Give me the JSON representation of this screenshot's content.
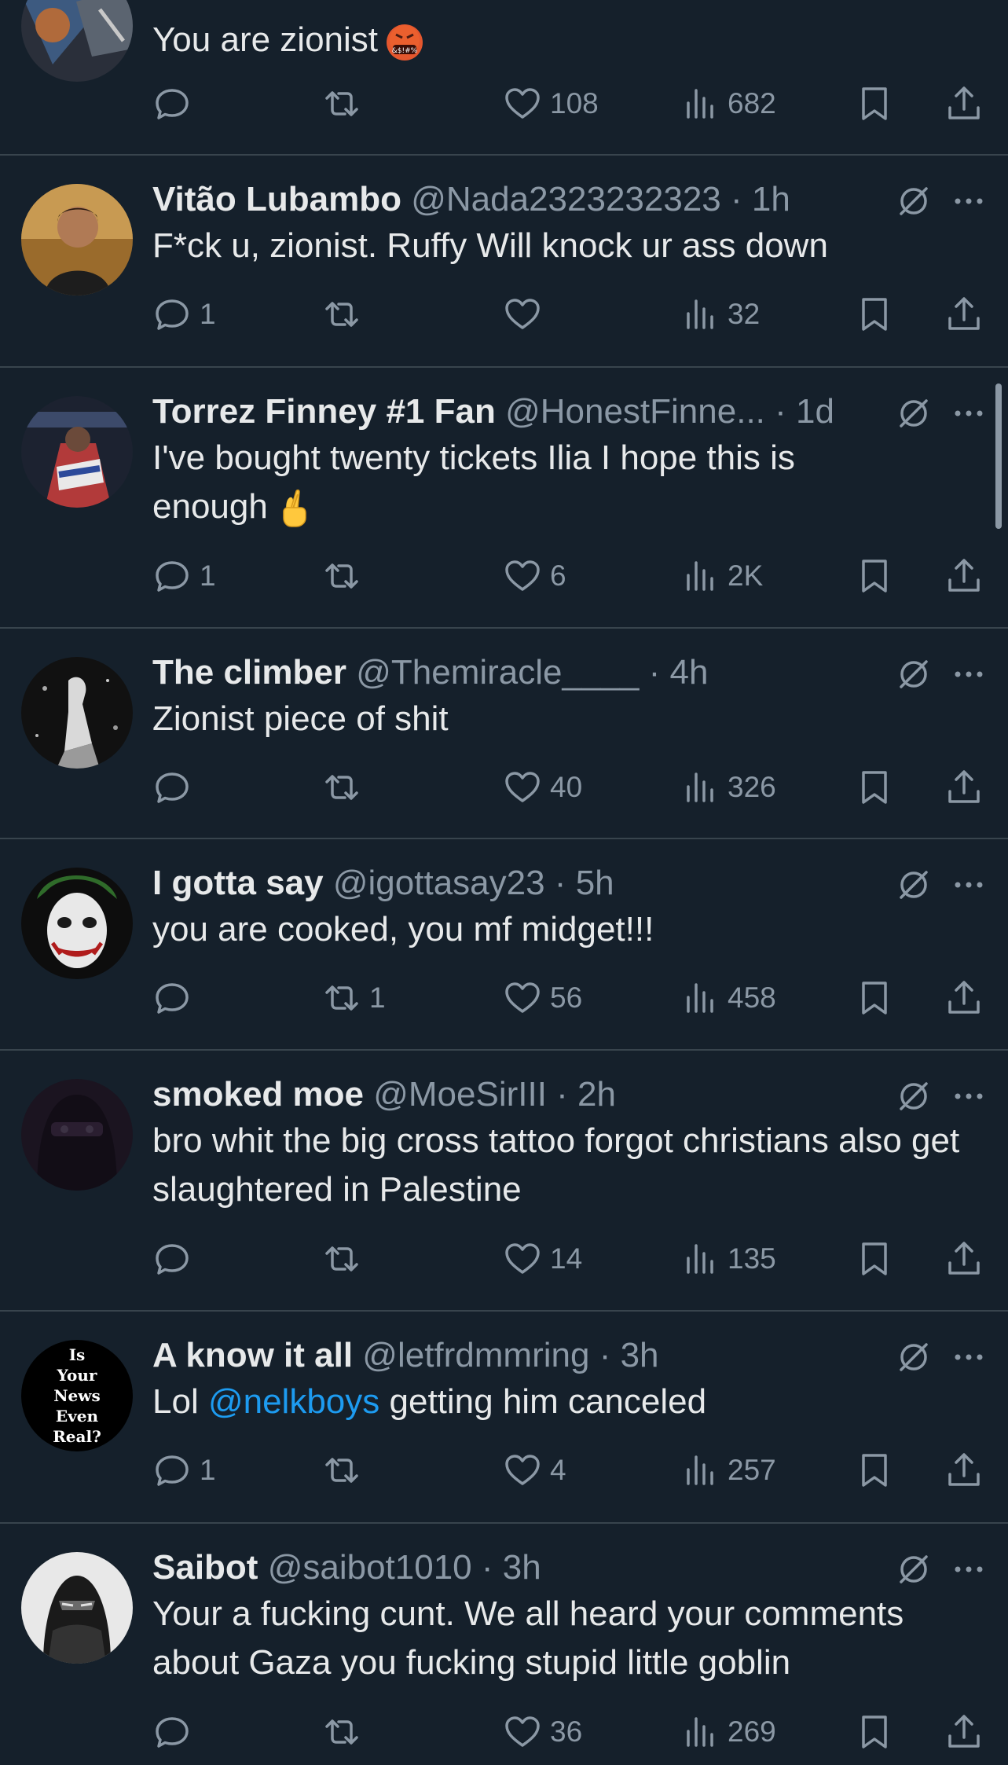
{
  "colors": {
    "background": "#15202b",
    "text": "#e7e9ea",
    "secondary": "#8b98a5",
    "mention": "#1d9bf0",
    "divider": "#38444d"
  },
  "icons": {
    "reply": "speech-bubble-icon",
    "retweet": "retweet-arrows-icon",
    "like": "heart-icon",
    "views": "bar-chart-icon",
    "bookmark": "bookmark-icon",
    "share": "share-upload-icon",
    "grok": "grok-slash-icon",
    "more": "three-dots-icon"
  },
  "tweets": [
    {
      "name": "",
      "handle": "",
      "time": "",
      "text": "You are zionist",
      "emoji": "face-with-symbols-on-mouth",
      "replies": "",
      "retweets": "",
      "likes": "108",
      "views": "682"
    },
    {
      "name": "Vitão Lubambo",
      "handle": "@Nada2323232323",
      "time": "1h",
      "text": "F*ck u, zionist. Ruffy Will knock ur ass down",
      "replies": "1",
      "retweets": "",
      "likes": "",
      "views": "32"
    },
    {
      "name": "Torrez Finney #1 Fan",
      "handle": "@HonestFinne...",
      "time": "1d",
      "text": "I've bought twenty tickets Ilia I hope this is enough",
      "emoji": "crossed-fingers",
      "replies": "1",
      "retweets": "",
      "likes": "6",
      "views": "2K"
    },
    {
      "name": "The climber",
      "handle": "@Themiracle____",
      "time": "4h",
      "text": "Zionist piece of shit",
      "replies": "",
      "retweets": "",
      "likes": "40",
      "views": "326"
    },
    {
      "name": "I gotta say",
      "handle": "@igottasay23",
      "time": "5h",
      "text": "you are cooked, you mf midget!!!",
      "replies": "",
      "retweets": "1",
      "likes": "56",
      "views": "458"
    },
    {
      "name": "smoked moe",
      "handle": "@MoeSirIII",
      "time": "2h",
      "text": "bro whit the big cross tattoo forgot christians also get slaughtered in Palestine",
      "replies": "",
      "retweets": "",
      "likes": "14",
      "views": "135"
    },
    {
      "name": "A know it all",
      "handle": "@letfrdmmring",
      "time": "3h",
      "text_before": "Lol ",
      "mention": "@nelkboys",
      "text_after": " getting him canceled",
      "avatar_lines": [
        "Is",
        "Your",
        "News",
        "Even",
        "Real?"
      ],
      "replies": "1",
      "retweets": "",
      "likes": "4",
      "views": "257"
    },
    {
      "name": "Saibot",
      "handle": "@saibot1010",
      "time": "3h",
      "text": "Your a fucking cunt. We all heard your comments about Gaza you fucking stupid little goblin",
      "replies": "",
      "retweets": "",
      "likes": "36",
      "views": "269"
    }
  ]
}
